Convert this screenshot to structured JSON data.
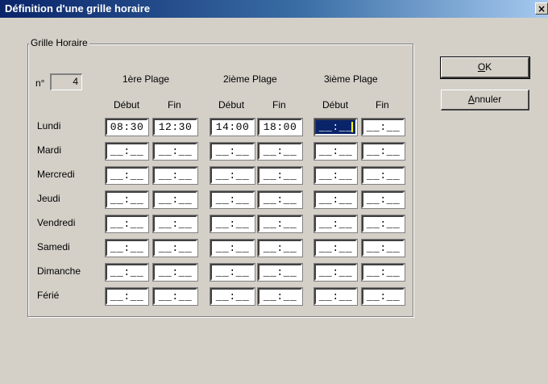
{
  "window": {
    "title": "Définition d'une grille horaire",
    "close_glyph": "×"
  },
  "group": {
    "legend": "Grille Horaire",
    "number_label": "n°",
    "number_value": "4"
  },
  "plages": [
    "1ère Plage",
    "2ième Plage",
    "3ième Plage"
  ],
  "columns": {
    "debut": "Début",
    "fin": "Fin"
  },
  "days": [
    "Lundi",
    "Mardi",
    "Mercredi",
    "Jeudi",
    "Vendredi",
    "Samedi",
    "Dimanche",
    "Férié"
  ],
  "empty_time": "__:__",
  "lundi_values": [
    "08:30",
    "12:30",
    "14:00",
    "18:00"
  ],
  "buttons": {
    "ok_label": "OK",
    "ok_mnemonic": "O",
    "ok_rest": "K",
    "cancel_label": "Annuler",
    "cancel_mnemonic": "A",
    "cancel_rest": "nnuler"
  },
  "colors": {
    "face": "#d4d0c8",
    "titlebar": "#0a246a",
    "focus": "#0a246a"
  }
}
